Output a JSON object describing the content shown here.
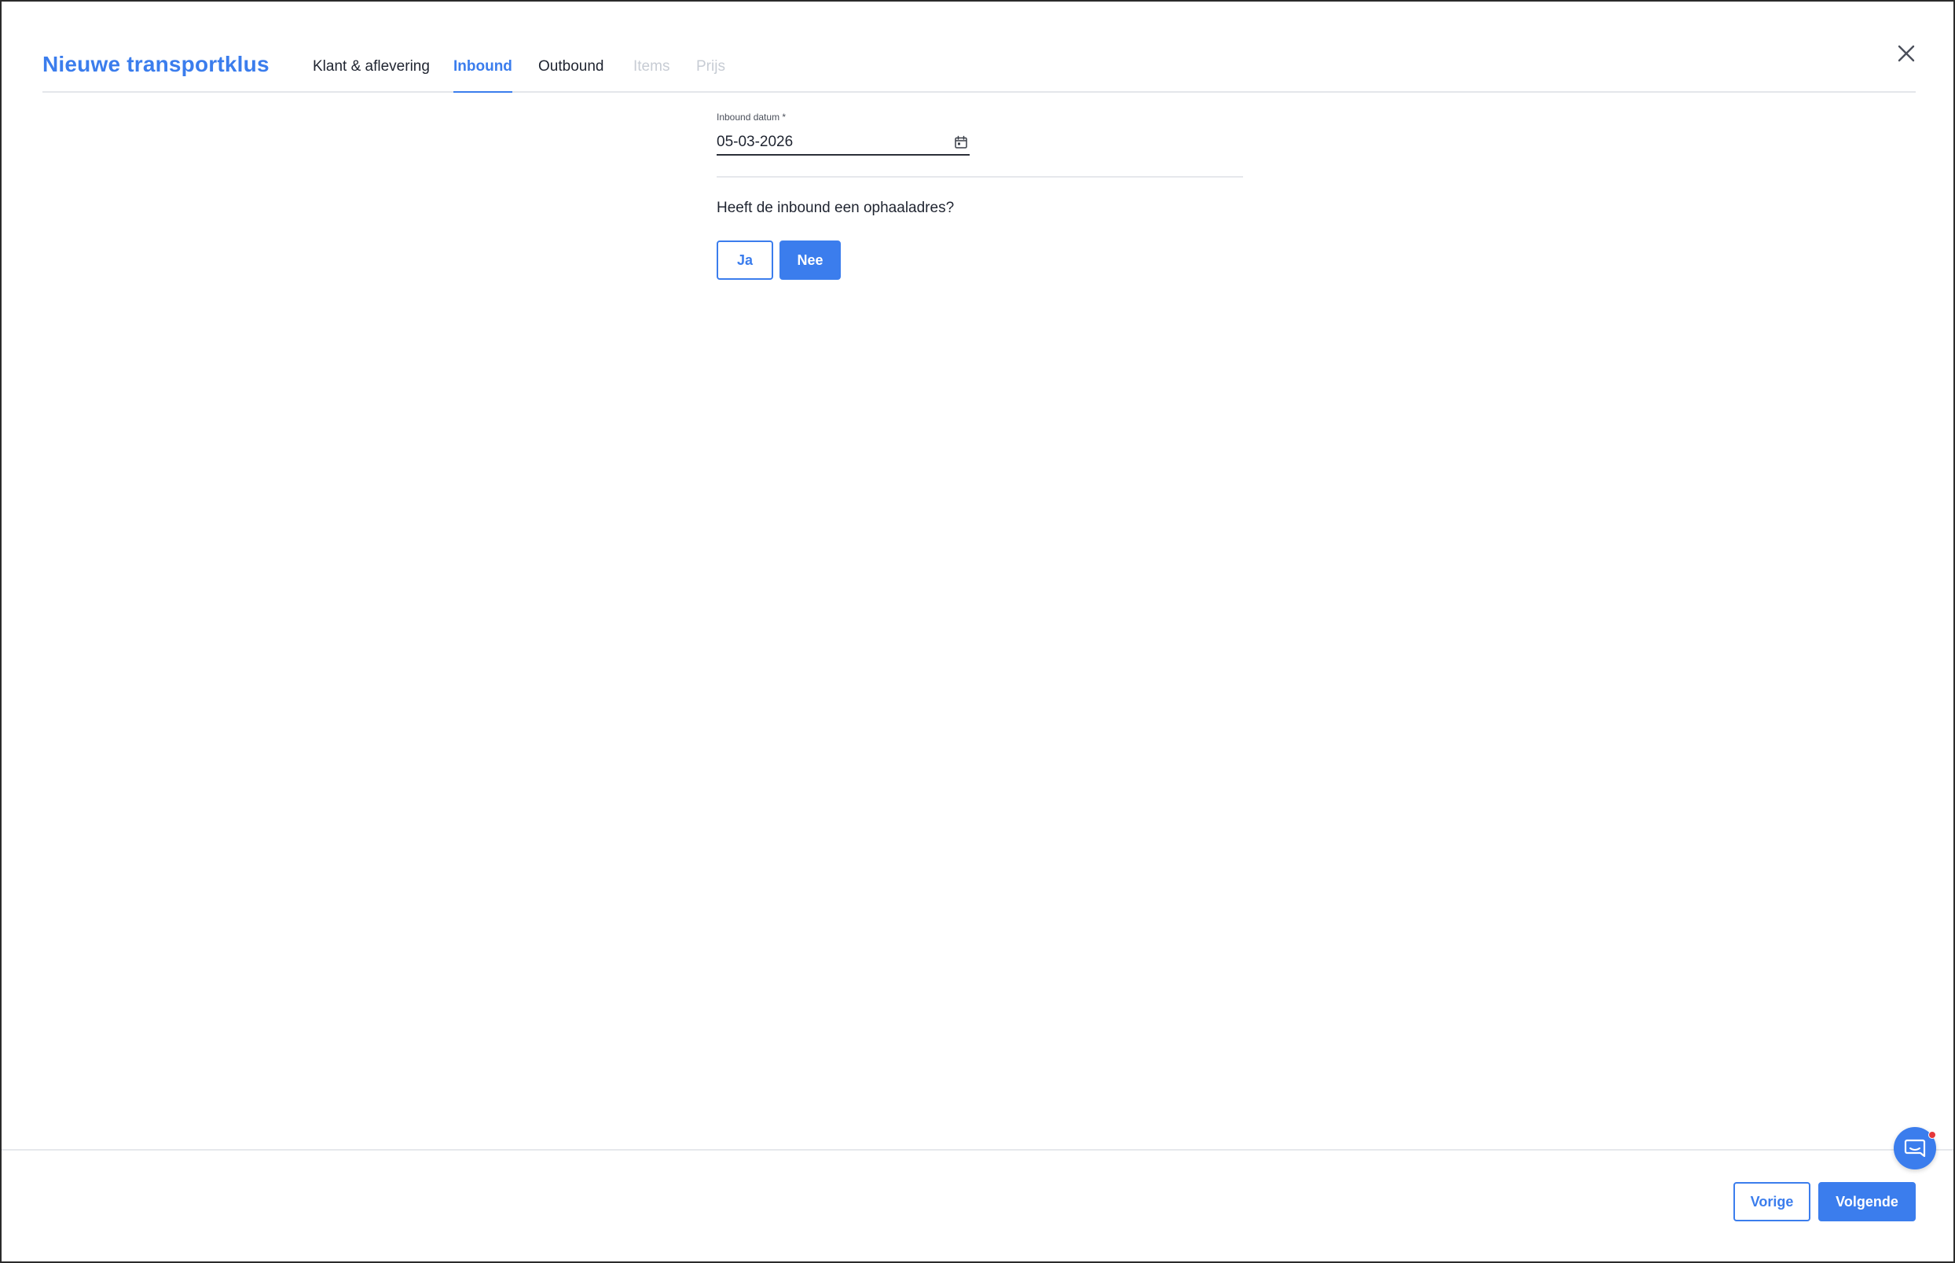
{
  "header": {
    "title": "Nieuwe transportklus",
    "tabs": [
      {
        "label": "Klant & aflevering",
        "state": "default"
      },
      {
        "label": "Inbound",
        "state": "active"
      },
      {
        "label": "Outbound",
        "state": "default"
      },
      {
        "label": "Items",
        "state": "disabled"
      },
      {
        "label": "Prijs",
        "state": "disabled"
      }
    ],
    "close_icon": "close-icon"
  },
  "form": {
    "date_label": "Inbound datum *",
    "date_value": "05-03-2026",
    "date_icon": "calendar-icon",
    "question": "Heeft de inbound een ophaaladres?",
    "yes_label": "Ja",
    "no_label": "Nee",
    "selected": "Nee"
  },
  "footer": {
    "prev_label": "Vorige",
    "next_label": "Volgende"
  },
  "chat": {
    "icon": "chat-icon",
    "has_notification": true
  },
  "colors": {
    "accent": "#3b7ded",
    "disabled_text": "#c7ccd4",
    "notification": "#e5383b"
  }
}
